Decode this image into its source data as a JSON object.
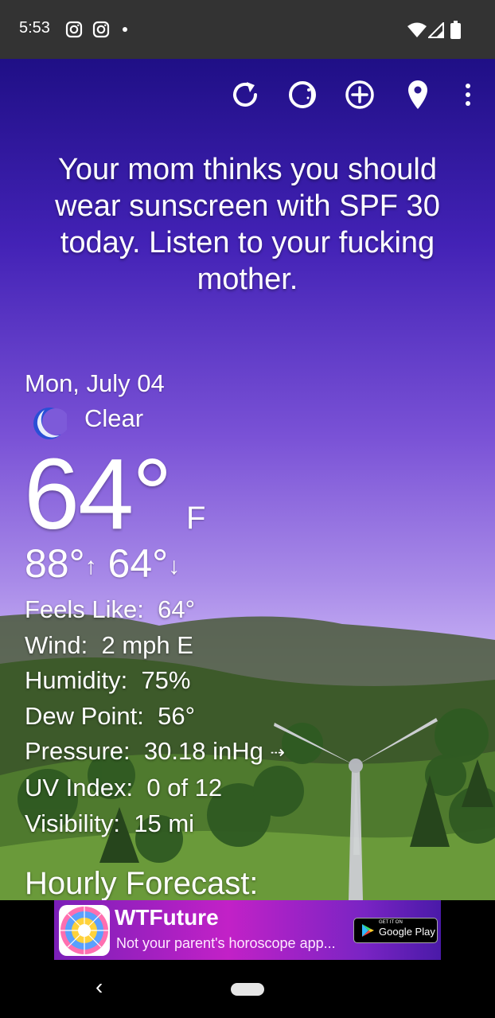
{
  "status_bar": {
    "time": "5:53",
    "icons": [
      "instagram-icon",
      "instagram-icon",
      "dot-icon",
      "wifi-icon",
      "signal-icon",
      "battery-icon"
    ]
  },
  "toolbar": {
    "icons": [
      "refresh-icon",
      "theme-icon",
      "add-location-icon",
      "location-pin-icon",
      "more-vert-icon"
    ]
  },
  "quote": "Your mom thinks you should wear sunscreen with SPF 30 today. Listen to your fucking mother.",
  "weather": {
    "date": "Mon, July 04",
    "condition": "Clear",
    "condition_icon": "crescent-moon-icon",
    "temperature": "64°",
    "unit": "F",
    "high": "88°",
    "low": "64°",
    "high_arrow": "↑",
    "low_arrow": "↓"
  },
  "details": [
    {
      "label": "Feels Like:",
      "value": "64°"
    },
    {
      "label": "Wind:",
      "value": "2 mph E"
    },
    {
      "label": "Humidity:",
      "value": "75%"
    },
    {
      "label": "Dew Point:",
      "value": "56°"
    },
    {
      "label": "Pressure:",
      "value": "30.18 inHg",
      "trend": "⇢"
    },
    {
      "label": "UV Index:",
      "value": "0 of 12"
    },
    {
      "label": "Visibility:",
      "value": "15 mi"
    }
  ],
  "hourly_heading": "Hourly Forecast:",
  "ad": {
    "title": "WTFuture",
    "subtitle": "Not your parent's horoscope app...",
    "store_small": "GET IT ON",
    "store_big": "Google Play"
  },
  "nav": {
    "back": "‹"
  },
  "colors": {
    "sky_top": "#1f0f86",
    "sky_bottom": "#d9c8fa",
    "hills": "#3f6a28",
    "ad_accent": "#c221c7"
  }
}
